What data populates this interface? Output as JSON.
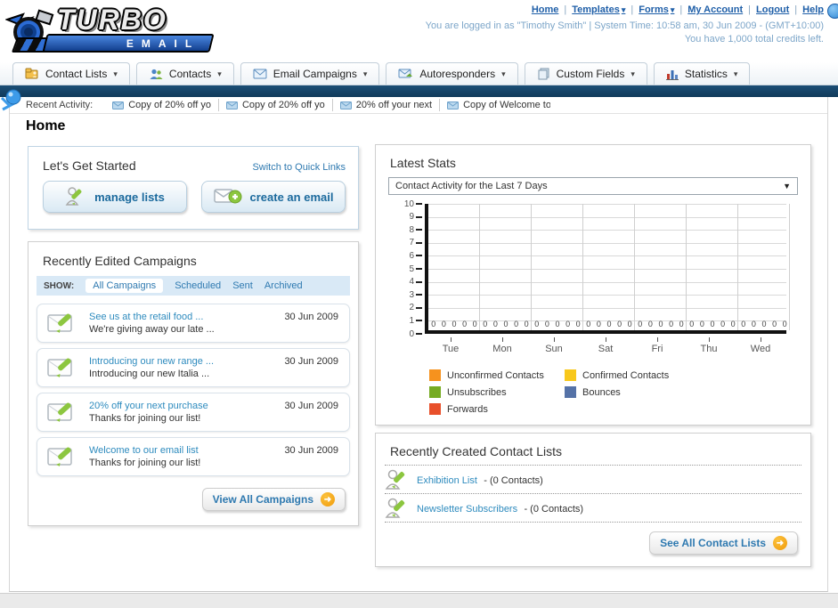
{
  "header": {
    "logo": {
      "title": "TURBO",
      "subtitle": "EMAIL"
    },
    "nav": [
      {
        "label": "Home"
      },
      {
        "label": "Templates"
      },
      {
        "label": "Forms"
      },
      {
        "label": "My Account"
      },
      {
        "label": "Logout"
      },
      {
        "label": "Help"
      }
    ],
    "login_info": "You are logged in as \"Timothy Smith\" | System Time: 10:58 am, 30 Jun 2009 - (GMT+10:00)",
    "credits_info": "You have 1,000 total credits left."
  },
  "tabs": [
    {
      "label": "Contact Lists"
    },
    {
      "label": "Contacts"
    },
    {
      "label": "Email Campaigns"
    },
    {
      "label": "Autoresponders"
    },
    {
      "label": "Custom Fields"
    },
    {
      "label": "Statistics"
    }
  ],
  "recent_activity": {
    "label": "Recent Activity:",
    "items": [
      "Copy of 20% off yo",
      "Copy of 20% off yo",
      "20% off your next",
      "Copy of Welcome to"
    ]
  },
  "page_title": "Home",
  "get_started": {
    "title": "Let's Get Started",
    "switch_link": "Switch to Quick Links",
    "manage_lists_label": "manage lists",
    "create_email_label": "create an email"
  },
  "campaigns": {
    "title": "Recently Edited Campaigns",
    "show_label": "SHOW:",
    "filters": [
      "All Campaigns",
      "Scheduled",
      "Sent",
      "Archived"
    ],
    "active_filter": "All Campaigns",
    "items": [
      {
        "title": "See us at the retail food ...",
        "subtitle": "We're giving away our late ...",
        "date": "30 Jun 2009"
      },
      {
        "title": "Introducing our new range ...",
        "subtitle": "Introducing our new Italia ...",
        "date": "30 Jun 2009"
      },
      {
        "title": "20% off your next purchase",
        "subtitle": "Thanks for joining our list!",
        "date": "30 Jun 2009"
      },
      {
        "title": "Welcome to our email list",
        "subtitle": "Thanks for joining our list!",
        "date": "30 Jun 2009"
      }
    ],
    "view_all_label": "View All Campaigns"
  },
  "stats": {
    "title": "Latest Stats",
    "selected_option": "Contact Activity for the Last 7 Days"
  },
  "chart_data": {
    "type": "bar",
    "title": "Contact Activity for the Last 7 Days",
    "categories": [
      "Tue",
      "Mon",
      "Sun",
      "Sat",
      "Fri",
      "Thu",
      "Wed"
    ],
    "series": [
      {
        "name": "Unconfirmed Contacts",
        "color": "#F6921E",
        "values": [
          0,
          0,
          0,
          0,
          0,
          0,
          0
        ]
      },
      {
        "name": "Confirmed Contacts",
        "color": "#F8C81C",
        "values": [
          0,
          0,
          0,
          0,
          0,
          0,
          0
        ]
      },
      {
        "name": "Unsubscribes",
        "color": "#76AB22",
        "values": [
          0,
          0,
          0,
          0,
          0,
          0,
          0
        ]
      },
      {
        "name": "Bounces",
        "color": "#5572A7",
        "values": [
          0,
          0,
          0,
          0,
          0,
          0,
          0
        ]
      },
      {
        "name": "Forwards",
        "color": "#E8502B",
        "values": [
          0,
          0,
          0,
          0,
          0,
          0,
          0
        ]
      }
    ],
    "xlabel": "",
    "ylabel": "",
    "ylim": [
      0,
      10
    ],
    "ytick_step": 1,
    "grid": true,
    "legend_position": "bottom"
  },
  "contact_lists": {
    "title": "Recently Created Contact Lists",
    "items": [
      {
        "name": "Exhibition List",
        "count": "- (0 Contacts)"
      },
      {
        "name": "Newsletter Subscribers",
        "count": "- (0 Contacts)"
      }
    ],
    "see_all_label": "See All Contact Lists"
  },
  "colors": {
    "navy_bar": "#123A5A",
    "link_blue": "#2E79B0",
    "button_text_blue": "#1B6A9D",
    "accent_orange": "#F09A0A"
  }
}
